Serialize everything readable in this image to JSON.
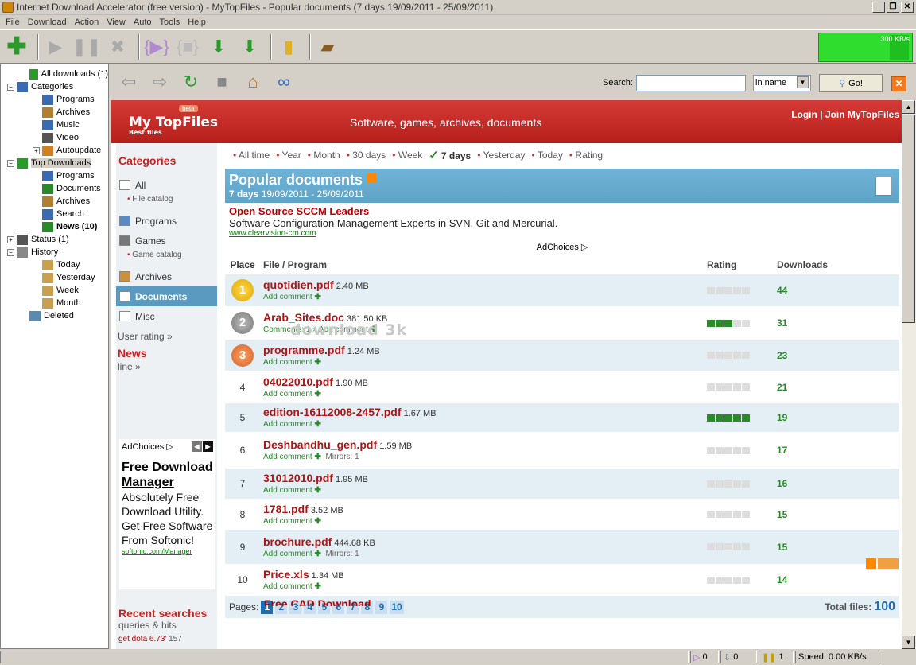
{
  "window": {
    "title": "Internet Download Accelerator (free version) - MyTopFiles - Popular documents (7 days 19/09/2011 - 25/09/2011)"
  },
  "menu": [
    "File",
    "Download",
    "Action",
    "View",
    "Auto",
    "Tools",
    "Help"
  ],
  "toolbar": {
    "speed_label": "300 KB/s"
  },
  "tree": [
    {
      "label": "All downloads (1)",
      "level": 1,
      "expander": "",
      "icon": "all-downloads-icon",
      "color": "#2a9a2a"
    },
    {
      "label": "Categories",
      "level": 0,
      "expander": "−",
      "icon": "categories-icon",
      "color": "#3a6ab0"
    },
    {
      "label": "Programs",
      "level": 2,
      "expander": "",
      "icon": "programs-icon",
      "color": "#3a6ab0"
    },
    {
      "label": "Archives",
      "level": 2,
      "expander": "",
      "icon": "archives-icon",
      "color": "#b08030"
    },
    {
      "label": "Music",
      "level": 2,
      "expander": "",
      "icon": "music-icon",
      "color": "#3a6ab0"
    },
    {
      "label": "Video",
      "level": 2,
      "expander": "",
      "icon": "video-icon",
      "color": "#555555"
    },
    {
      "label": "Autoupdate",
      "level": 2,
      "expander": "+",
      "icon": "autoupdate-icon",
      "color": "#d08020"
    },
    {
      "label": "Top Downloads",
      "level": 0,
      "expander": "−",
      "icon": "top-downloads-icon",
      "color": "#2a9a2a",
      "selected": true
    },
    {
      "label": "Programs",
      "level": 2,
      "expander": "",
      "icon": "programs-icon",
      "color": "#3a6ab0"
    },
    {
      "label": "Documents",
      "level": 2,
      "expander": "",
      "icon": "documents-icon",
      "color": "#2a8a2a"
    },
    {
      "label": "Archives",
      "level": 2,
      "expander": "",
      "icon": "archives-icon",
      "color": "#b08030"
    },
    {
      "label": "Search",
      "level": 2,
      "expander": "",
      "icon": "search-icon",
      "color": "#3a6ab0"
    },
    {
      "label": "News (10)",
      "level": 2,
      "expander": "",
      "icon": "news-icon",
      "color": "#2a8a2a",
      "bold": true
    },
    {
      "label": "Status (1)",
      "level": 0,
      "expander": "+",
      "icon": "status-icon",
      "color": "#555555"
    },
    {
      "label": "History",
      "level": 0,
      "expander": "−",
      "icon": "history-icon",
      "color": "#888888"
    },
    {
      "label": "Today",
      "level": 2,
      "expander": "",
      "icon": "calendar-icon",
      "color": "#c8a050"
    },
    {
      "label": "Yesterday",
      "level": 2,
      "expander": "",
      "icon": "calendar-icon",
      "color": "#c8a050"
    },
    {
      "label": "Week",
      "level": 2,
      "expander": "",
      "icon": "calendar-icon",
      "color": "#c8a050"
    },
    {
      "label": "Month",
      "level": 2,
      "expander": "",
      "icon": "calendar-icon",
      "color": "#c8a050"
    },
    {
      "label": "Deleted",
      "level": 1,
      "expander": "",
      "icon": "trash-icon",
      "color": "#5a8ab0"
    }
  ],
  "browser": {
    "search_label": "Search:",
    "search_value": "",
    "search_scope": "in name",
    "go_label": "Go!"
  },
  "site": {
    "logo_name": "My TopFiles",
    "logo_tag": "Best files",
    "beta": "beta",
    "slogan": "Software, games, archives, documents",
    "login": "Login",
    "join": "Join MyTopFiles",
    "categories_title": "Categories",
    "cat_all": "All",
    "cat_file_catalog": "File catalog",
    "cat_programs": "Programs",
    "cat_games": "Games",
    "cat_game_catalog": "Game catalog",
    "cat_archives": "Archives",
    "cat_documents": "Documents",
    "cat_misc": "Misc",
    "user_rating": "User rating »",
    "news_title": "News",
    "news_line": "line »",
    "ad_choices": "AdChoices",
    "ad_title": "Free Download Manager",
    "ad_body": "Absolutely Free Download Utility. Get Free Software From Softonic!",
    "ad_url": "softonic.com/Manager",
    "recent_title": "Recent searches",
    "recent_sub": "queries & hits",
    "recent_item": "get dota 6.73'",
    "recent_hits": "157",
    "watermark": "download 3k"
  },
  "periods": [
    {
      "label": "All time"
    },
    {
      "label": "Year"
    },
    {
      "label": "Month"
    },
    {
      "label": "30 days"
    },
    {
      "label": "Week"
    },
    {
      "label": "7 days",
      "current": true
    },
    {
      "label": "Yesterday"
    },
    {
      "label": "Today"
    },
    {
      "label": "Rating"
    }
  ],
  "popular": {
    "title": "Popular documents",
    "period": "7 days",
    "range": "19/09/2011 - 25/09/2011"
  },
  "sponsor": {
    "title": "Open Source SCCM Leaders",
    "desc": "Software Configuration Management Experts in SVN, Git and Mercurial.",
    "url": "www.clearvision-cm.com",
    "adchoices": "AdChoices"
  },
  "table": {
    "headers": [
      "Place",
      "File / Program",
      "Rating",
      "Downloads"
    ],
    "rows": [
      {
        "place": "1",
        "medal": "gold",
        "name": "quotidien.pdf",
        "size": "2.40 MB",
        "comments": "",
        "mirrors": "",
        "rating": 0,
        "downloads": "44"
      },
      {
        "place": "2",
        "medal": "silver",
        "name": "Arab_Sites.doc",
        "size": "381.50 KB",
        "comments": "Comments: 1",
        "mirrors": "",
        "rating": 3,
        "downloads": "31"
      },
      {
        "place": "3",
        "medal": "bronze",
        "name": "programme.pdf",
        "size": "1.24 MB",
        "comments": "",
        "mirrors": "",
        "rating": 0,
        "downloads": "23"
      },
      {
        "place": "4",
        "medal": "",
        "name": "04022010.pdf",
        "size": "1.90 MB",
        "comments": "",
        "mirrors": "",
        "rating": 0,
        "downloads": "21"
      },
      {
        "place": "5",
        "medal": "",
        "name": "edition-16112008-2457.pdf",
        "size": "1.67 MB",
        "comments": "",
        "mirrors": "",
        "rating": 5,
        "downloads": "19"
      },
      {
        "place": "6",
        "medal": "",
        "name": "Deshbandhu_gen.pdf",
        "size": "1.59 MB",
        "comments": "",
        "mirrors": "Mirrors: 1",
        "rating": 0,
        "downloads": "17"
      },
      {
        "place": "7",
        "medal": "",
        "name": "31012010.pdf",
        "size": "1.95 MB",
        "comments": "",
        "mirrors": "",
        "rating": 0,
        "downloads": "16"
      },
      {
        "place": "8",
        "medal": "",
        "name": "1781.pdf",
        "size": "3.52 MB",
        "comments": "",
        "mirrors": "",
        "rating": 0,
        "downloads": "15"
      },
      {
        "place": "9",
        "medal": "",
        "name": "brochure.pdf",
        "size": "444.68 KB",
        "comments": "",
        "mirrors": "Mirrors: 1",
        "rating": 0,
        "downloads": "15"
      },
      {
        "place": "10",
        "medal": "",
        "name": "Price.xls",
        "size": "1.34 MB",
        "comments": "",
        "mirrors": "",
        "rating": 0,
        "downloads": "14"
      }
    ],
    "add_comment": "Add comment"
  },
  "pagination": {
    "label": "Pages:",
    "pages": [
      "1",
      "2",
      "3",
      "4",
      "5",
      "6",
      "7",
      "8",
      "9",
      "10"
    ],
    "total_label": "Total files:",
    "total": "100"
  },
  "next_ad": "Free CAD Download",
  "status": {
    "a": "0",
    "b": "0",
    "c": "1",
    "speed": "Speed: 0.00 KB/s"
  }
}
